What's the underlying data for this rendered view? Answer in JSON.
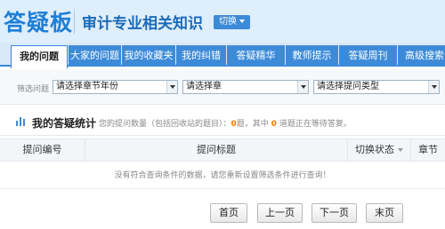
{
  "header": {
    "logo_text": "答疑板",
    "app_title": "审计专业相关知识",
    "switch_label": "切换"
  },
  "tabs": [
    {
      "label": "我的问题",
      "active": true
    },
    {
      "label": "大家的问题",
      "active": false
    },
    {
      "label": "我的收藏夹",
      "active": false
    },
    {
      "label": "我的纠错",
      "active": false
    },
    {
      "label": "答疑精华",
      "active": false
    },
    {
      "label": "教师提示",
      "active": false
    },
    {
      "label": "答疑周刊",
      "active": false
    },
    {
      "label": "高级搜索",
      "active": false
    }
  ],
  "filters": {
    "label": "筛选问题",
    "year_select": "请选择章节年份",
    "chapter_select": "请选择章",
    "type_select": "请选择提问类型"
  },
  "stats": {
    "title": "我的答疑统计",
    "text_before": "您的提问数量（包括回收站的题目）：",
    "total_count": "0",
    "text_middle": "题，其中",
    "pending_count": "0",
    "text_after": "道题正在等待答复。"
  },
  "table": {
    "columns": [
      "提问编号",
      "提问标题",
      "切换状态",
      "章节"
    ],
    "empty_message": "没有符合查询条件的数据，请您重新设置筛选条件进行查询！"
  },
  "pager": {
    "first": "首页",
    "prev": "上一页",
    "next": "下一页",
    "last": "末页"
  },
  "colors": {
    "accent": "#3d8bd8",
    "header_bg": "#dfeefb",
    "highlight_number": "#f07c00"
  }
}
